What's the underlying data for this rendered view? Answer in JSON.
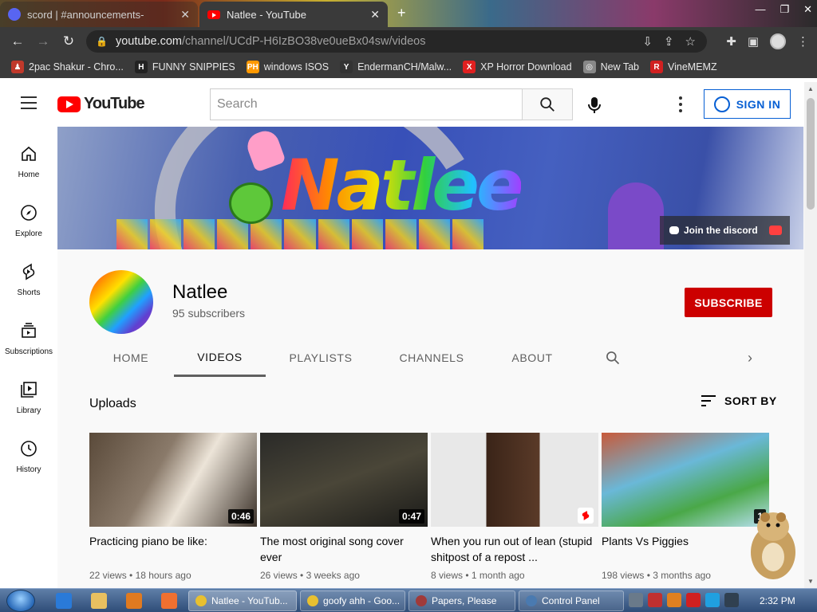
{
  "browser": {
    "tabs": [
      {
        "label": "scord | #announcements-",
        "active": false
      },
      {
        "label": "Natlee - YouTube",
        "active": true
      }
    ],
    "url_host": "youtube.com",
    "url_path": "/channel/UCdP-H6IzBO38ve0ueBx04sw/videos",
    "bookmarks": [
      {
        "label": "2pac Shakur - Chro...",
        "icon": "person-icon",
        "color": "#c0392b"
      },
      {
        "label": "FUNNY SNIPPIES",
        "icon": "h-icon",
        "color": "#222222"
      },
      {
        "label": "windows ISOS",
        "icon": "ph-icon",
        "color": "#ff9900"
      },
      {
        "label": "EndermanCH/Malw...",
        "icon": "yp-icon",
        "color": "#333333"
      },
      {
        "label": "XP Horror Download",
        "icon": "x-icon",
        "color": "#e02020"
      },
      {
        "label": "New Tab",
        "icon": "globe-icon",
        "color": "#888888"
      },
      {
        "label": "VineMEMZ",
        "icon": "r-icon",
        "color": "#d02020"
      }
    ]
  },
  "youtube": {
    "logo_text": "YouTube",
    "search_placeholder": "Search",
    "signin_label": "SIGN IN",
    "guide": [
      {
        "label": "Home",
        "icon": "home-icon"
      },
      {
        "label": "Explore",
        "icon": "compass-icon"
      },
      {
        "label": "Shorts",
        "icon": "shorts-icon"
      },
      {
        "label": "Subscriptions",
        "icon": "subscriptions-icon"
      },
      {
        "label": "Library",
        "icon": "library-icon"
      },
      {
        "label": "History",
        "icon": "history-icon"
      }
    ],
    "banner": {
      "title": "Natlee",
      "discord_link": "Join the discord"
    },
    "channel": {
      "name": "Natlee",
      "subscribers": "95 subscribers",
      "subscribe_label": "SUBSCRIBE"
    },
    "tabs": [
      "HOME",
      "VIDEOS",
      "PLAYLISTS",
      "CHANNELS",
      "ABOUT"
    ],
    "selected_tab": "VIDEOS",
    "uploads_title": "Uploads",
    "sort_label": "SORT BY",
    "videos": [
      {
        "title": "Practicing piano be like:",
        "duration": "0:46",
        "views": "22 views",
        "age": "18 hours ago"
      },
      {
        "title": "The most original song cover ever",
        "duration": "0:47",
        "views": "26 views",
        "age": "3 weeks ago"
      },
      {
        "title": "When you run out of lean (stupid shitpost of a repost ...",
        "duration": "",
        "views": "8 views",
        "age": "1 month ago"
      },
      {
        "title": "Plants Vs Piggies",
        "duration": "1",
        "views": "198 views",
        "age": "3 months ago"
      }
    ]
  },
  "taskbar": {
    "tasks": [
      {
        "label": "Natlee - YouTub...",
        "active": true
      },
      {
        "label": "goofy ahh - Goo...",
        "active": false
      },
      {
        "label": "Papers, Please",
        "active": false
      },
      {
        "label": "Control Panel",
        "active": false
      }
    ],
    "clock": "2:32 PM"
  }
}
